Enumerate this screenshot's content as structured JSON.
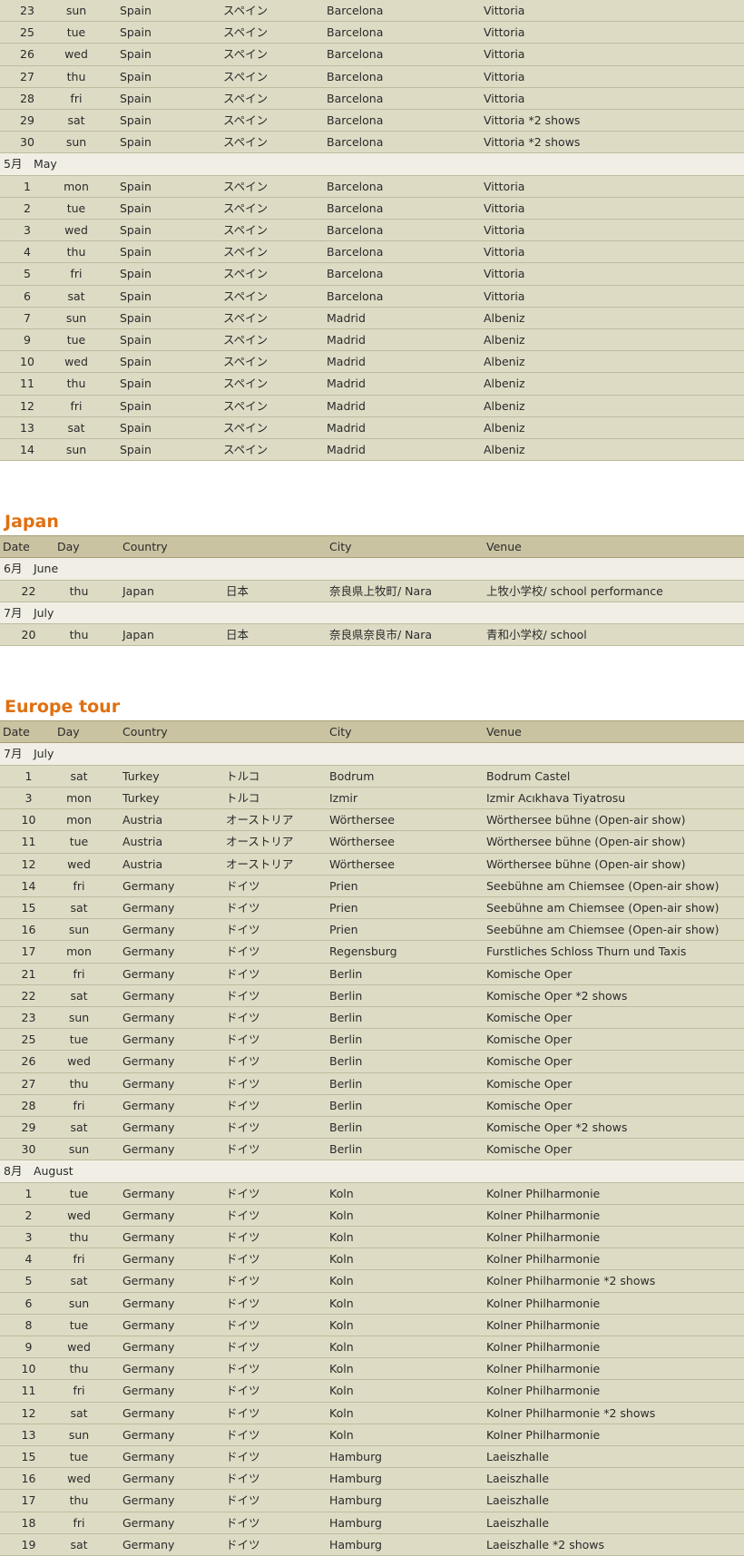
{
  "headers": {
    "date": "Date",
    "day": "Day",
    "country": "Country",
    "city": "City",
    "venue": "Venue"
  },
  "sections": [
    {
      "title": "",
      "show_header": false,
      "groups": [
        {
          "month": "",
          "rows": [
            [
              "23",
              "sun",
              "Spain",
              "スペイン",
              "Barcelona",
              "Vittoria"
            ],
            [
              "25",
              "tue",
              "Spain",
              "スペイン",
              "Barcelona",
              "Vittoria"
            ],
            [
              "26",
              "wed",
              "Spain",
              "スペイン",
              "Barcelona",
              "Vittoria"
            ],
            [
              "27",
              "thu",
              "Spain",
              "スペイン",
              "Barcelona",
              "Vittoria"
            ],
            [
              "28",
              "fri",
              "Spain",
              "スペイン",
              "Barcelona",
              "Vittoria"
            ],
            [
              "29",
              "sat",
              "Spain",
              "スペイン",
              "Barcelona",
              "Vittoria *2 shows"
            ],
            [
              "30",
              "sun",
              "Spain",
              "スペイン",
              "Barcelona",
              "Vittoria *2 shows"
            ]
          ]
        },
        {
          "month": "5月　May",
          "rows": [
            [
              "1",
              "mon",
              "Spain",
              "スペイン",
              "Barcelona",
              "Vittoria"
            ],
            [
              "2",
              "tue",
              "Spain",
              "スペイン",
              "Barcelona",
              "Vittoria"
            ],
            [
              "3",
              "wed",
              "Spain",
              "スペイン",
              "Barcelona",
              "Vittoria"
            ],
            [
              "4",
              "thu",
              "Spain",
              "スペイン",
              "Barcelona",
              "Vittoria"
            ],
            [
              "5",
              "fri",
              "Spain",
              "スペイン",
              "Barcelona",
              "Vittoria"
            ],
            [
              "6",
              "sat",
              "Spain",
              "スペイン",
              "Barcelona",
              "Vittoria"
            ],
            [
              "7",
              "sun",
              "Spain",
              "スペイン",
              "Madrid",
              "Albeniz"
            ],
            [
              "9",
              "tue",
              "Spain",
              "スペイン",
              "Madrid",
              "Albeniz"
            ],
            [
              "10",
              "wed",
              "Spain",
              "スペイン",
              "Madrid",
              "Albeniz"
            ],
            [
              "11",
              "thu",
              "Spain",
              "スペイン",
              "Madrid",
              "Albeniz"
            ],
            [
              "12",
              "fri",
              "Spain",
              "スペイン",
              "Madrid",
              "Albeniz"
            ],
            [
              "13",
              "sat",
              "Spain",
              "スペイン",
              "Madrid",
              "Albeniz"
            ],
            [
              "14",
              "sun",
              "Spain",
              "スペイン",
              "Madrid",
              "Albeniz"
            ]
          ]
        }
      ]
    },
    {
      "title": "Japan",
      "show_header": true,
      "groups": [
        {
          "month": "6月　June",
          "rows": [
            [
              "22",
              "thu",
              "Japan",
              "日本",
              "奈良県上牧町/ Nara",
              "上牧小学校/ school performance"
            ]
          ]
        },
        {
          "month": "7月　July",
          "rows": [
            [
              "20",
              "thu",
              "Japan",
              "日本",
              "奈良県奈良市/ Nara",
              "青和小学校/ school"
            ]
          ]
        }
      ]
    },
    {
      "title": "Europe tour",
      "show_header": true,
      "groups": [
        {
          "month": "7月　July",
          "rows": [
            [
              "1",
              "sat",
              "Turkey",
              "トルコ",
              "Bodrum",
              "Bodrum Castel"
            ],
            [
              "3",
              "mon",
              "Turkey",
              "トルコ",
              "Izmir",
              "Izmir Acıkhava Tiyatrosu"
            ],
            [
              "10",
              "mon",
              "Austria",
              "オーストリア",
              "Wörthersee",
              "Wörthersee bühne (Open-air show)"
            ],
            [
              "11",
              "tue",
              "Austria",
              "オーストリア",
              "Wörthersee",
              "Wörthersee bühne (Open-air show)"
            ],
            [
              "12",
              "wed",
              "Austria",
              "オーストリア",
              "Wörthersee",
              "Wörthersee bühne (Open-air show)"
            ],
            [
              "14",
              "fri",
              "Germany",
              "ドイツ",
              "Prien",
              "Seebühne am Chiemsee (Open-air show)"
            ],
            [
              "15",
              "sat",
              "Germany",
              "ドイツ",
              "Prien",
              "Seebühne am Chiemsee (Open-air show)"
            ],
            [
              "16",
              "sun",
              "Germany",
              "ドイツ",
              "Prien",
              "Seebühne am Chiemsee (Open-air show)"
            ],
            [
              "17",
              "mon",
              "Germany",
              "ドイツ",
              "Regensburg",
              "Furstliches Schloss Thurn und Taxis"
            ],
            [
              "21",
              "fri",
              "Germany",
              "ドイツ",
              "Berlin",
              "Komische Oper"
            ],
            [
              "22",
              "sat",
              "Germany",
              "ドイツ",
              "Berlin",
              "Komische Oper *2 shows"
            ],
            [
              "23",
              "sun",
              "Germany",
              "ドイツ",
              "Berlin",
              "Komische Oper"
            ],
            [
              "25",
              "tue",
              "Germany",
              "ドイツ",
              "Berlin",
              "Komische Oper"
            ],
            [
              "26",
              "wed",
              "Germany",
              "ドイツ",
              "Berlin",
              "Komische Oper"
            ],
            [
              "27",
              "thu",
              "Germany",
              "ドイツ",
              "Berlin",
              "Komische Oper"
            ],
            [
              "28",
              "fri",
              "Germany",
              "ドイツ",
              "Berlin",
              "Komische Oper"
            ],
            [
              "29",
              "sat",
              "Germany",
              "ドイツ",
              "Berlin",
              "Komische Oper *2 shows"
            ],
            [
              "30",
              "sun",
              "Germany",
              "ドイツ",
              "Berlin",
              "Komische Oper"
            ]
          ]
        },
        {
          "month": "8月　August",
          "rows": [
            [
              "1",
              "tue",
              "Germany",
              "ドイツ",
              "Koln",
              "Kolner Philharmonie"
            ],
            [
              "2",
              "wed",
              "Germany",
              "ドイツ",
              "Koln",
              "Kolner Philharmonie"
            ],
            [
              "3",
              "thu",
              "Germany",
              "ドイツ",
              "Koln",
              "Kolner Philharmonie"
            ],
            [
              "4",
              "fri",
              "Germany",
              "ドイツ",
              "Koln",
              "Kolner Philharmonie"
            ],
            [
              "5",
              "sat",
              "Germany",
              "ドイツ",
              "Koln",
              "Kolner Philharmonie *2 shows"
            ],
            [
              "6",
              "sun",
              "Germany",
              "ドイツ",
              "Koln",
              "Kolner Philharmonie"
            ],
            [
              "8",
              "tue",
              "Germany",
              "ドイツ",
              "Koln",
              "Kolner Philharmonie"
            ],
            [
              "9",
              "wed",
              "Germany",
              "ドイツ",
              "Koln",
              "Kolner Philharmonie"
            ],
            [
              "10",
              "thu",
              "Germany",
              "ドイツ",
              "Koln",
              "Kolner Philharmonie"
            ],
            [
              "11",
              "fri",
              "Germany",
              "ドイツ",
              "Koln",
              "Kolner Philharmonie"
            ],
            [
              "12",
              "sat",
              "Germany",
              "ドイツ",
              "Koln",
              "Kolner Philharmonie *2 shows"
            ],
            [
              "13",
              "sun",
              "Germany",
              "ドイツ",
              "Koln",
              "Kolner Philharmonie"
            ],
            [
              "15",
              "tue",
              "Germany",
              "ドイツ",
              "Hamburg",
              "Laeiszhalle"
            ],
            [
              "16",
              "wed",
              "Germany",
              "ドイツ",
              "Hamburg",
              "Laeiszhalle"
            ],
            [
              "17",
              "thu",
              "Germany",
              "ドイツ",
              "Hamburg",
              "Laeiszhalle"
            ],
            [
              "18",
              "fri",
              "Germany",
              "ドイツ",
              "Hamburg",
              "Laeiszhalle"
            ],
            [
              "19",
              "sat",
              "Germany",
              "ドイツ",
              "Hamburg",
              "Laeiszhalle *2 shows"
            ]
          ]
        }
      ]
    }
  ]
}
